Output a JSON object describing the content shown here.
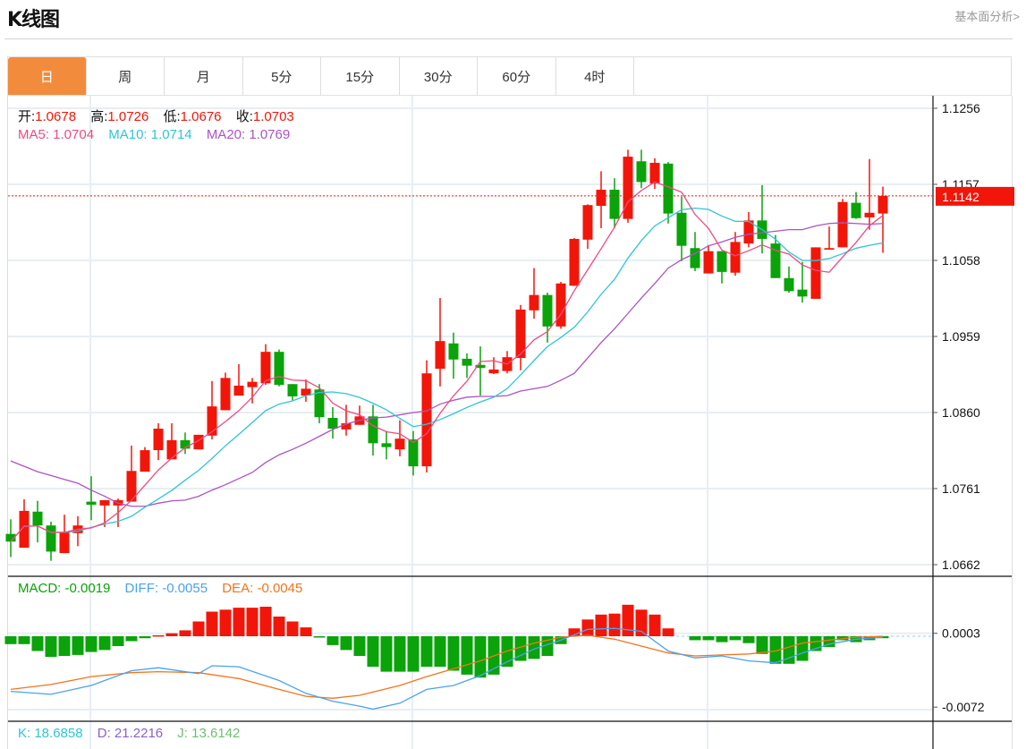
{
  "header": {
    "title": "K线图",
    "fundamental_link": "基本面分析>"
  },
  "tabs": [
    {
      "label": "日",
      "active": true
    },
    {
      "label": "周"
    },
    {
      "label": "月"
    },
    {
      "label": "5分"
    },
    {
      "label": "15分"
    },
    {
      "label": "30分"
    },
    {
      "label": "60分"
    },
    {
      "label": "4时"
    }
  ],
  "ohlc_legend": {
    "open_label": "开:",
    "open": "1.0678",
    "high_label": "高:",
    "high": "1.0726",
    "low_label": "低:",
    "low": "1.0676",
    "close_label": "收:",
    "close": "1.0703"
  },
  "ma_legend": {
    "ma5": "MA5: 1.0704",
    "ma10": "MA10: 1.0714",
    "ma20": "MA20: 1.0769"
  },
  "macd_legend": {
    "macd": "MACD: -0.0019",
    "diff": "DIFF: -0.0055",
    "dea": "DEA: -0.0045"
  },
  "kdj_legend": {
    "k": "K: 18.6858",
    "d": "D: 21.2216",
    "j": "J: 13.6142"
  },
  "colors": {
    "up": "#f2160a",
    "down": "#0aa30a",
    "ma5": "#ef4a80",
    "ma10": "#2fc5d6",
    "ma20": "#ad52c4",
    "diff": "#4aa2ef",
    "dea": "#f5741b",
    "accent": "#f28c3c"
  },
  "chart_data": {
    "type": "candlestick",
    "price_axis": {
      "range": [
        1.0662,
        1.1256
      ],
      "ticks": [
        "1.1256",
        "1.1157",
        "1.1058",
        "1.0959",
        "1.0860",
        "1.0761",
        "1.0662"
      ]
    },
    "current_price": "1.1142",
    "candles": [
      [
        1.0702,
        1.0721,
        1.0672,
        1.0692
      ],
      [
        1.0684,
        1.0747,
        1.0684,
        1.0732
      ],
      [
        1.0731,
        1.0745,
        1.0691,
        1.0713
      ],
      [
        1.0713,
        1.0718,
        1.0667,
        1.0679
      ],
      [
        1.0677,
        1.0727,
        1.0677,
        1.0704
      ],
      [
        1.0703,
        1.0725,
        1.0686,
        1.0713
      ],
      [
        1.0744,
        1.0777,
        1.072,
        1.074
      ],
      [
        1.0739,
        1.0746,
        1.0711,
        1.0746
      ],
      [
        1.0739,
        1.0748,
        1.0711,
        1.0746
      ],
      [
        1.0744,
        1.0817,
        1.0744,
        1.0784
      ],
      [
        1.0783,
        1.0815,
        1.0783,
        1.0811
      ],
      [
        1.0811,
        1.0846,
        1.0798,
        1.0839
      ],
      [
        1.0799,
        1.0846,
        1.0799,
        1.0824
      ],
      [
        1.0824,
        1.0834,
        1.0806,
        1.0813
      ],
      [
        1.0812,
        1.0831,
        1.0812,
        1.0831
      ],
      [
        1.083,
        1.0901,
        1.0825,
        1.0868
      ],
      [
        1.0863,
        1.0912,
        1.0863,
        1.0905
      ],
      [
        1.0882,
        1.0923,
        1.0882,
        1.0895
      ],
      [
        1.0893,
        1.0905,
        1.0872,
        1.09
      ],
      [
        1.0898,
        1.0949,
        1.0896,
        1.0939
      ],
      [
        1.0939,
        1.0942,
        1.0894,
        1.0896
      ],
      [
        1.0897,
        1.0897,
        1.0876,
        1.0881
      ],
      [
        1.0882,
        1.0903,
        1.0874,
        1.0891
      ],
      [
        1.089,
        1.0897,
        1.0846,
        1.0854
      ],
      [
        1.0853,
        1.0867,
        1.0826,
        1.0839
      ],
      [
        1.0838,
        1.087,
        1.083,
        1.0846
      ],
      [
        1.0844,
        1.0869,
        1.0844,
        1.0855
      ],
      [
        1.0855,
        1.087,
        1.0804,
        1.082
      ],
      [
        1.082,
        1.0836,
        1.0799,
        1.0815
      ],
      [
        1.0812,
        1.085,
        1.0803,
        1.0826
      ],
      [
        1.0825,
        1.0836,
        1.0778,
        1.079
      ],
      [
        1.079,
        1.0928,
        1.0782,
        1.0911
      ],
      [
        1.0917,
        1.1009,
        1.0894,
        1.0953
      ],
      [
        1.095,
        1.0964,
        1.0904,
        1.0929
      ],
      [
        1.093,
        1.0937,
        1.0905,
        1.0921
      ],
      [
        1.0922,
        1.0946,
        1.0882,
        1.0918
      ],
      [
        1.0911,
        1.0932,
        1.091,
        1.0916
      ],
      [
        1.0914,
        1.094,
        1.0911,
        1.0932
      ],
      [
        1.0931,
        1.1,
        1.0915,
        1.0994
      ],
      [
        1.0993,
        1.1048,
        1.0982,
        1.1013
      ],
      [
        1.1013,
        1.1016,
        1.0951,
        1.0972
      ],
      [
        1.0972,
        1.103,
        1.0969,
        1.1028
      ],
      [
        1.1025,
        1.1087,
        1.1025,
        1.1086
      ],
      [
        1.1085,
        1.1131,
        1.1073,
        1.113
      ],
      [
        1.1129,
        1.1174,
        1.11,
        1.115
      ],
      [
        1.115,
        1.1165,
        1.11,
        1.1112
      ],
      [
        1.1112,
        1.1202,
        1.1107,
        1.1193
      ],
      [
        1.1187,
        1.1202,
        1.1152,
        1.116
      ],
      [
        1.1158,
        1.1191,
        1.1151,
        1.1185
      ],
      [
        1.1184,
        1.1186,
        1.1106,
        1.1119
      ],
      [
        1.112,
        1.1141,
        1.1057,
        1.1077
      ],
      [
        1.1074,
        1.1095,
        1.1044,
        1.1048
      ],
      [
        1.1041,
        1.1078,
        1.1041,
        1.107
      ],
      [
        1.107,
        1.107,
        1.1028,
        1.1043
      ],
      [
        1.1042,
        1.1095,
        1.1038,
        1.1082
      ],
      [
        1.108,
        1.1121,
        1.1075,
        1.111
      ],
      [
        1.111,
        1.1156,
        1.1067,
        1.1086
      ],
      [
        1.108,
        1.1091,
        1.1035,
        1.1035
      ],
      [
        1.1035,
        1.105,
        1.1016,
        1.1018
      ],
      [
        1.102,
        1.1056,
        1.1003,
        1.1011
      ],
      [
        1.1008,
        1.1075,
        1.1008,
        1.1075
      ],
      [
        1.1072,
        1.1102,
        1.1072,
        1.1074
      ],
      [
        1.1075,
        1.1138,
        1.1075,
        1.1134
      ],
      [
        1.1133,
        1.1147,
        1.1112,
        1.1113
      ],
      [
        1.1114,
        1.119,
        1.1098,
        1.112
      ],
      [
        1.1119,
        1.1154,
        1.1068,
        1.1142
      ]
    ],
    "ma20": [
      1.0797,
      1.079,
      1.0783,
      1.0778,
      1.0773,
      1.0768,
      1.0759,
      1.0751,
      1.0742,
      1.0738,
      1.0738,
      1.0742,
      1.0745,
      1.0746,
      1.0751,
      1.0759,
      1.0766,
      1.0774,
      1.0782,
      1.0795,
      1.0805,
      1.0812,
      1.082,
      1.0829,
      1.0838,
      1.0845,
      1.085,
      1.0853,
      1.0854,
      1.0857,
      1.086,
      1.0862,
      1.0871,
      1.0876,
      1.088,
      1.0881,
      1.0881,
      1.0882,
      1.0888,
      1.0891,
      1.0894,
      1.0902,
      1.0911,
      1.0931,
      1.0951,
      1.0969,
      1.0989,
      1.1009,
      1.1028,
      1.1048,
      1.1059,
      1.1067,
      1.1077,
      1.1082,
      1.1088,
      1.1092,
      1.1094,
      1.1096,
      1.1098,
      1.1098,
      1.1103,
      1.1106,
      1.1107,
      1.1106,
      1.1105,
      1.1106
    ],
    "macd_axis": {
      "ticks": [
        "0.0003",
        "-0.0072"
      ]
    },
    "macd_hist": [
      -0.0008,
      -0.0008,
      -0.0015,
      -0.0021,
      -0.002,
      -0.0019,
      -0.0016,
      -0.0014,
      -0.001,
      -0.0005,
      -0.0002,
      0.0001,
      0.0003,
      0.0006,
      0.0015,
      0.0025,
      0.0027,
      0.0029,
      0.0029,
      0.003,
      0.002,
      0.0015,
      0.0009,
      -0.0001,
      -0.0009,
      -0.0014,
      -0.002,
      -0.0031,
      -0.0036,
      -0.0036,
      -0.0036,
      -0.0031,
      -0.0031,
      -0.0035,
      -0.0039,
      -0.0042,
      -0.0039,
      -0.0031,
      -0.0025,
      -0.0023,
      -0.002,
      -0.0008,
      0.0008,
      0.0017,
      0.0022,
      0.0023,
      0.0032,
      0.0027,
      0.0022,
      0.0008,
      0.0,
      -0.0004,
      -0.0004,
      -0.0006,
      -0.0004,
      -0.0007,
      -0.0018,
      -0.0028,
      -0.0028,
      -0.0025,
      -0.0015,
      -0.0011,
      -0.0004,
      -0.0006,
      -0.0004,
      -0.0002
    ],
    "diff": [
      [
        0,
        -0.0056
      ],
      [
        3,
        -0.0059
      ],
      [
        6,
        -0.005
      ],
      [
        9,
        -0.0035
      ],
      [
        11,
        -0.0032
      ],
      [
        14,
        -0.0038
      ],
      [
        15,
        -0.003
      ],
      [
        17,
        -0.0031
      ],
      [
        20,
        -0.0045
      ],
      [
        22,
        -0.0058
      ],
      [
        24,
        -0.0066
      ],
      [
        26,
        -0.0071
      ],
      [
        27,
        -0.0074
      ],
      [
        29,
        -0.0068
      ],
      [
        31,
        -0.0054
      ],
      [
        33,
        -0.005
      ],
      [
        35,
        -0.004
      ],
      [
        37,
        -0.0026
      ],
      [
        39,
        -0.0013
      ],
      [
        41,
        -0.0004
      ],
      [
        43,
        0.0007
      ],
      [
        45,
        0.0008
      ],
      [
        47,
        0.0005
      ],
      [
        49,
        -0.0015
      ],
      [
        51,
        -0.0022
      ],
      [
        53,
        -0.002
      ],
      [
        55,
        -0.0025
      ],
      [
        57,
        -0.0027
      ],
      [
        59,
        -0.0017
      ],
      [
        61,
        -0.0008
      ],
      [
        63,
        -0.0003
      ],
      [
        65,
        -0.0001
      ]
    ],
    "dea": [
      [
        0,
        -0.0054
      ],
      [
        3,
        -0.0049
      ],
      [
        6,
        -0.0041
      ],
      [
        9,
        -0.0037
      ],
      [
        11,
        -0.0036
      ],
      [
        14,
        -0.0037
      ],
      [
        17,
        -0.0043
      ],
      [
        20,
        -0.0054
      ],
      [
        22,
        -0.0061
      ],
      [
        24,
        -0.0063
      ],
      [
        26,
        -0.006
      ],
      [
        29,
        -0.005
      ],
      [
        31,
        -0.0041
      ],
      [
        33,
        -0.0033
      ],
      [
        35,
        -0.0025
      ],
      [
        37,
        -0.0015
      ],
      [
        39,
        -0.0007
      ],
      [
        41,
        -0.0001
      ],
      [
        43,
        0.0001
      ],
      [
        45,
        -0.0003
      ],
      [
        47,
        -0.001
      ],
      [
        49,
        -0.0017
      ],
      [
        51,
        -0.002
      ],
      [
        53,
        -0.0019
      ],
      [
        55,
        -0.0018
      ],
      [
        57,
        -0.0015
      ],
      [
        59,
        -0.0007
      ],
      [
        61,
        -0.0004
      ],
      [
        63,
        -0.0001
      ],
      [
        65,
        0.0
      ]
    ]
  }
}
